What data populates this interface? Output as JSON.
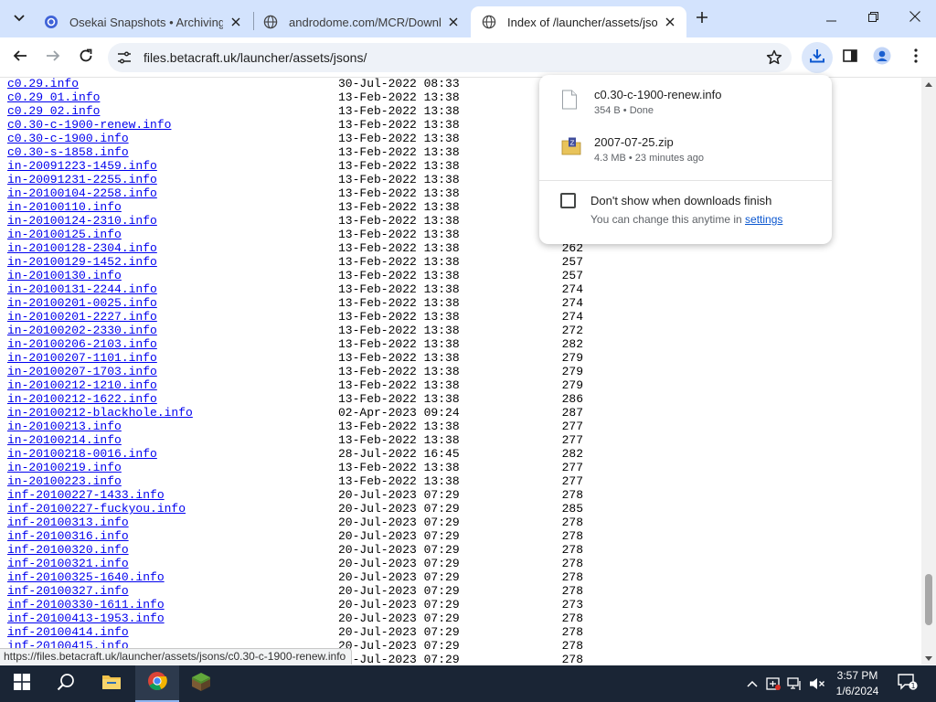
{
  "browser": {
    "tabs": [
      {
        "title": "Osekai Snapshots • Archiving o",
        "active": false,
        "favicon": "osekai-icon"
      },
      {
        "title": "androdome.com/MCR/Downlo",
        "active": false,
        "favicon": "globe-icon"
      },
      {
        "title": "Index of /launcher/assets/jsons",
        "active": true,
        "favicon": "globe-icon"
      }
    ],
    "url": "files.betacraft.uk/launcher/assets/jsons/",
    "accent_color": "#d3e3fd"
  },
  "listing": {
    "rows": [
      {
        "name": "c0.29.info",
        "date": "30-Jul-2022 08:33",
        "size": ""
      },
      {
        "name": "c0.29_01.info",
        "date": "13-Feb-2022 13:38",
        "size": ""
      },
      {
        "name": "c0.29_02.info",
        "date": "13-Feb-2022 13:38",
        "size": ""
      },
      {
        "name": "c0.30-c-1900-renew.info",
        "date": "13-Feb-2022 13:38",
        "size": ""
      },
      {
        "name": "c0.30-c-1900.info",
        "date": "13-Feb-2022 13:38",
        "size": ""
      },
      {
        "name": "c0.30-s-1858.info",
        "date": "13-Feb-2022 13:38",
        "size": ""
      },
      {
        "name": "in-20091223-1459.info",
        "date": "13-Feb-2022 13:38",
        "size": ""
      },
      {
        "name": "in-20091231-2255.info",
        "date": "13-Feb-2022 13:38",
        "size": ""
      },
      {
        "name": "in-20100104-2258.info",
        "date": "13-Feb-2022 13:38",
        "size": ""
      },
      {
        "name": "in-20100110.info",
        "date": "13-Feb-2022 13:38",
        "size": ""
      },
      {
        "name": "in-20100124-2310.info",
        "date": "13-Feb-2022 13:38",
        "size": ""
      },
      {
        "name": "in-20100125.info",
        "date": "13-Feb-2022 13:38",
        "size": ""
      },
      {
        "name": "in-20100128-2304.info",
        "date": "13-Feb-2022 13:38",
        "size": "262"
      },
      {
        "name": "in-20100129-1452.info",
        "date": "13-Feb-2022 13:38",
        "size": "257"
      },
      {
        "name": "in-20100130.info",
        "date": "13-Feb-2022 13:38",
        "size": "257"
      },
      {
        "name": "in-20100131-2244.info",
        "date": "13-Feb-2022 13:38",
        "size": "274"
      },
      {
        "name": "in-20100201-0025.info",
        "date": "13-Feb-2022 13:38",
        "size": "274"
      },
      {
        "name": "in-20100201-2227.info",
        "date": "13-Feb-2022 13:38",
        "size": "274"
      },
      {
        "name": "in-20100202-2330.info",
        "date": "13-Feb-2022 13:38",
        "size": "272"
      },
      {
        "name": "in-20100206-2103.info",
        "date": "13-Feb-2022 13:38",
        "size": "282"
      },
      {
        "name": "in-20100207-1101.info",
        "date": "13-Feb-2022 13:38",
        "size": "279"
      },
      {
        "name": "in-20100207-1703.info",
        "date": "13-Feb-2022 13:38",
        "size": "279"
      },
      {
        "name": "in-20100212-1210.info",
        "date": "13-Feb-2022 13:38",
        "size": "279"
      },
      {
        "name": "in-20100212-1622.info",
        "date": "13-Feb-2022 13:38",
        "size": "286"
      },
      {
        "name": "in-20100212-blackhole.info",
        "date": "02-Apr-2023 09:24",
        "size": "287"
      },
      {
        "name": "in-20100213.info",
        "date": "13-Feb-2022 13:38",
        "size": "277"
      },
      {
        "name": "in-20100214.info",
        "date": "13-Feb-2022 13:38",
        "size": "277"
      },
      {
        "name": "in-20100218-0016.info",
        "date": "28-Jul-2022 16:45",
        "size": "282"
      },
      {
        "name": "in-20100219.info",
        "date": "13-Feb-2022 13:38",
        "size": "277"
      },
      {
        "name": "in-20100223.info",
        "date": "13-Feb-2022 13:38",
        "size": "277"
      },
      {
        "name": "inf-20100227-1433.info",
        "date": "20-Jul-2023 07:29",
        "size": "278"
      },
      {
        "name": "inf-20100227-fuckyou.info",
        "date": "20-Jul-2023 07:29",
        "size": "285"
      },
      {
        "name": "inf-20100313.info",
        "date": "20-Jul-2023 07:29",
        "size": "278"
      },
      {
        "name": "inf-20100316.info",
        "date": "20-Jul-2023 07:29",
        "size": "278"
      },
      {
        "name": "inf-20100320.info",
        "date": "20-Jul-2023 07:29",
        "size": "278"
      },
      {
        "name": "inf-20100321.info",
        "date": "20-Jul-2023 07:29",
        "size": "278"
      },
      {
        "name": "inf-20100325-1640.info",
        "date": "20-Jul-2023 07:29",
        "size": "278"
      },
      {
        "name": "inf-20100327.info",
        "date": "20-Jul-2023 07:29",
        "size": "278"
      },
      {
        "name": "inf-20100330-1611.info",
        "date": "20-Jul-2023 07:29",
        "size": "273"
      },
      {
        "name": "inf-20100413-1953.info",
        "date": "20-Jul-2023 07:29",
        "size": "278"
      },
      {
        "name": "inf-20100414.info",
        "date": "20-Jul-2023 07:29",
        "size": "278"
      },
      {
        "name": "inf-20100415.info",
        "date": "20-Jul-2023 07:29",
        "size": "278"
      },
      {
        "name": "",
        "date": "20-Jul-2023 07:29",
        "size": "278"
      }
    ]
  },
  "status_bar": {
    "url": "https://files.betacraft.uk/launcher/assets/jsons/c0.30-c-1900-renew.info"
  },
  "downloads": {
    "items": [
      {
        "name": "c0.30-c-1900-renew.info",
        "meta": "354 B • Done",
        "icon": "file-icon"
      },
      {
        "name": "2007-07-25.zip",
        "meta": "4.3 MB • 23 minutes ago",
        "icon": "zip-folder-icon"
      }
    ],
    "checkbox_label": "Don't show when downloads finish",
    "note_prefix": "You can change this anytime in ",
    "note_link": "settings"
  },
  "taskbar": {
    "time": "3:57 PM",
    "date": "1/6/2024",
    "notification_count": "1",
    "pinned": [
      "start-icon",
      "search-icon",
      "file-explorer-icon",
      "chrome-icon",
      "minecraft-icon"
    ]
  }
}
